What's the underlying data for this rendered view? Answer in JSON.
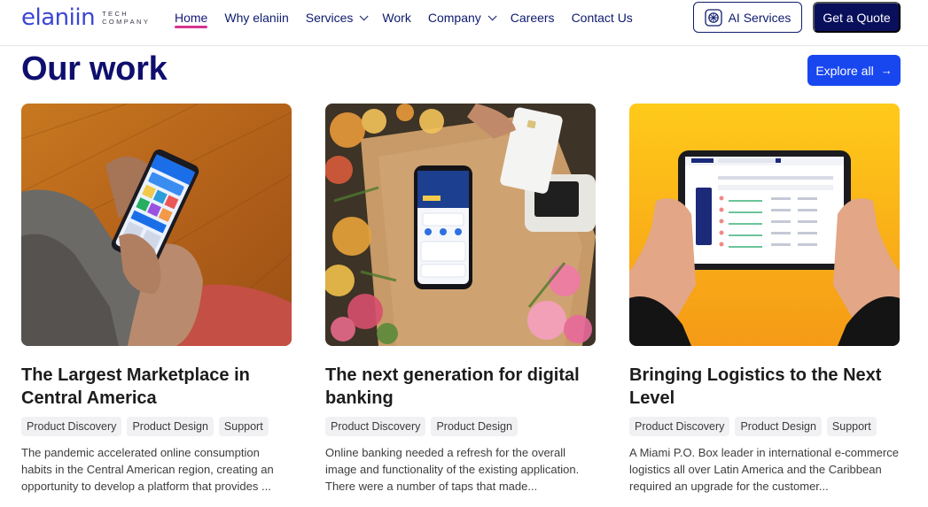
{
  "brand": {
    "name": "elaniin",
    "tagline": "TECH COMPANY"
  },
  "nav": {
    "items": [
      {
        "label": "Home",
        "active": true,
        "dropdown": false
      },
      {
        "label": "Why elaniin",
        "active": false,
        "dropdown": false
      },
      {
        "label": "Services",
        "active": false,
        "dropdown": true
      },
      {
        "label": "Work",
        "active": false,
        "dropdown": false
      },
      {
        "label": "Company",
        "active": false,
        "dropdown": true
      },
      {
        "label": "Careers",
        "active": false,
        "dropdown": false
      },
      {
        "label": "Contact Us",
        "active": false,
        "dropdown": false
      }
    ],
    "ai_button": "AI Services",
    "quote_button": "Get a Quote"
  },
  "section": {
    "title": "Our work",
    "explore_label": "Explore all",
    "explore_icon": "arrow-right-icon"
  },
  "cards": [
    {
      "title": "The Largest Marketplace in Central America",
      "tags": [
        "Product Discovery",
        "Product Design",
        "Support"
      ],
      "description": "The pandemic accelerated online consumption habits in the Central American region, creating an opportunity to develop a platform that provides ..."
    },
    {
      "title": "The next generation for digital banking",
      "tags": [
        "Product Discovery",
        "Product Design"
      ],
      "description": "Online banking needed a refresh for the overall image and functionality of the existing application. There were a number of taps that made..."
    },
    {
      "title": "Bringing Logistics to the Next Level",
      "tags": [
        "Product Discovery",
        "Product Design",
        "Support"
      ],
      "description": "A Miami P.O. Box leader in international e-commerce logistics all over Latin America and the Caribbean required an upgrade for the customer..."
    }
  ],
  "colors": {
    "brand": "#3b45d6",
    "navy": "#0a0f5c",
    "accent": "#1847f0",
    "active_underline": "#d6338f"
  }
}
